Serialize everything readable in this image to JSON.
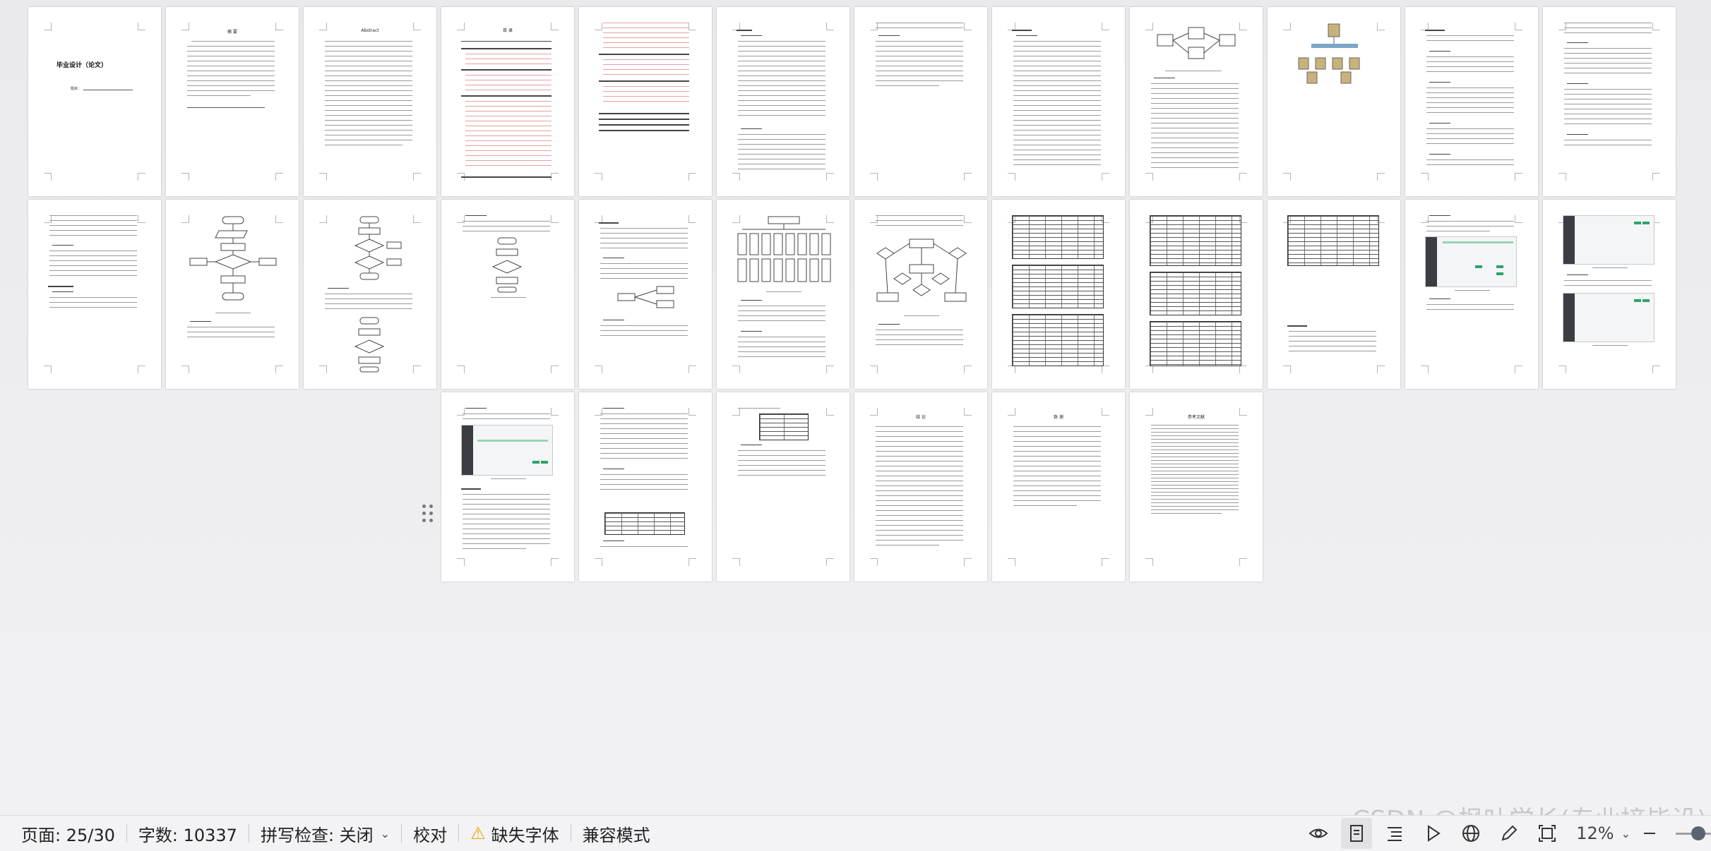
{
  "document": {
    "cover_title": "毕业设计（论文）",
    "cover_subtitle": "题目：",
    "abstract_head": "摘 要",
    "abstract_en_head": "Abstract",
    "toc_head": "目 录",
    "ack_head": "致 谢",
    "conclusion_head": "结 论",
    "refs_head": "参考文献",
    "page_count": 30
  },
  "statusbar": {
    "page_info": "页面: 25/30",
    "word_count": "字数: 10337",
    "spell_check": "拼写检查: 关闭",
    "proofread": "校对",
    "missing_fonts": "缺失字体",
    "compat_mode": "兼容模式",
    "zoom": "12%",
    "zoom_value_percent": 12
  },
  "watermark": {
    "text": "CSDN @枫叶学长(专业接毕设)"
  },
  "colors": {
    "accent_green": "#2ea36a",
    "warning": "#e9a400",
    "page_bg": "#ffffff",
    "canvas_bg": "#f1f1f3"
  },
  "icons": {
    "reading_mode": "eye-icon",
    "page_view": "page-view-icon",
    "outline_view": "outline-icon",
    "play": "play-icon",
    "web_layout": "globe-icon",
    "pen": "pen-icon",
    "fit": "fit-icon",
    "zoom_out": "minus-icon",
    "drag_handle": "drag-handle-icon"
  }
}
